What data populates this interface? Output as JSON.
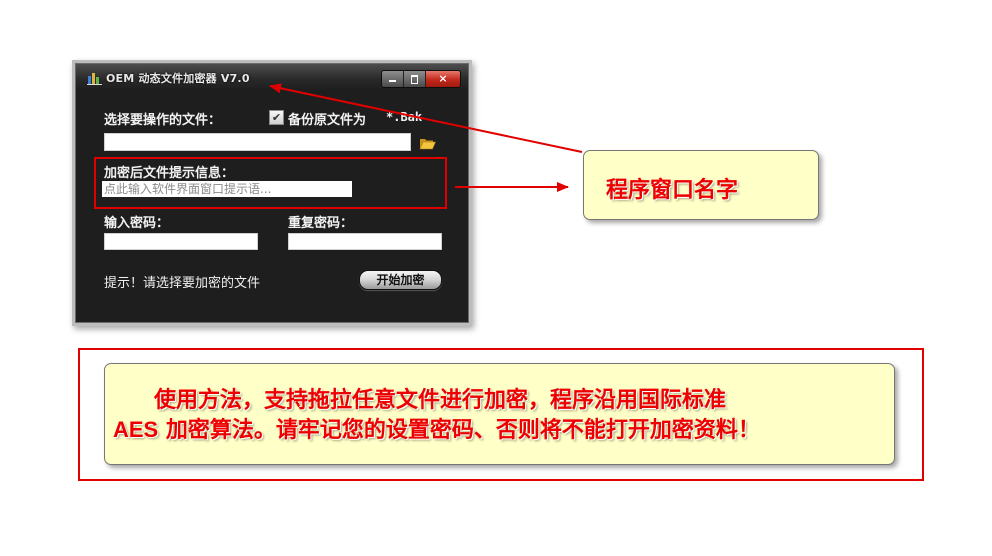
{
  "window": {
    "title": "OEM 动态文件加密器 V7.0",
    "controls": {
      "minimize": "－",
      "maximize": "□",
      "close": "×"
    }
  },
  "form": {
    "select_file_label": "选择要操作的文件：",
    "backup_checkbox_label": "备份原文件为",
    "backup_checkbox_checked": true,
    "backup_ext": "*.Bak",
    "file_path_value": "",
    "hint_label": "加密后文件提示信息：",
    "hint_placeholder": "点此输入软件界面窗口提示语...",
    "password_label": "输入密码：",
    "repeat_password_label": "重复密码：",
    "password_value": "",
    "repeat_password_value": "",
    "status_text": "提示！请选择要加密的文件",
    "start_button": "开始加密"
  },
  "annotations": {
    "window_name_callout": "程序窗口名字",
    "usage_line1": "使用方法，支持拖拉任意文件进行加密，程序沿用国际标准",
    "usage_line2_prefix": "AES",
    "usage_line2_rest": " 加密算法。请牢记您的设置密码、否则将不能打开加密资料！",
    "accent_color": "#ee0000",
    "callout_bg": "#ffffc8"
  }
}
